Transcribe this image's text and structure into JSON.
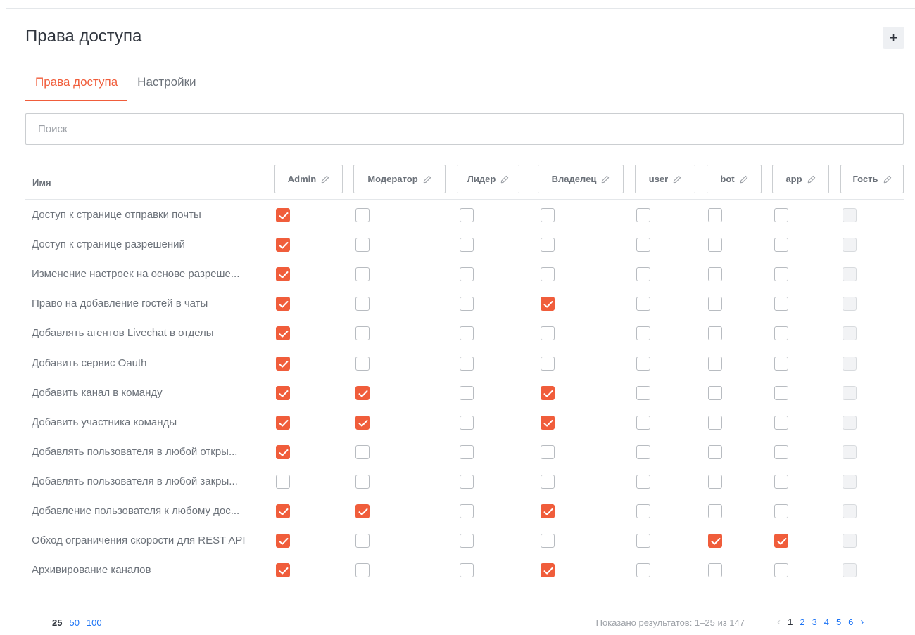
{
  "page": {
    "title": "Права доступа"
  },
  "tabs": [
    {
      "label": "Права доступа",
      "active": true
    },
    {
      "label": "Настройки",
      "active": false
    }
  ],
  "search": {
    "placeholder": "Поиск",
    "value": ""
  },
  "table": {
    "name_header": "Имя",
    "roles": [
      "Admin",
      "Модератор",
      "Лидер",
      "Владелец",
      "user",
      "bot",
      "app",
      "Гость"
    ],
    "rows": [
      {
        "name": "Доступ к странице отправки почты",
        "checks": [
          1,
          0,
          0,
          0,
          0,
          0,
          0,
          0
        ]
      },
      {
        "name": "Доступ к странице разрешений",
        "checks": [
          1,
          0,
          0,
          0,
          0,
          0,
          0,
          0
        ]
      },
      {
        "name": "Изменение настроек на основе разреше...",
        "checks": [
          1,
          0,
          0,
          0,
          0,
          0,
          0,
          0
        ]
      },
      {
        "name": "Право на добавление гостей в чаты",
        "checks": [
          1,
          0,
          0,
          1,
          0,
          0,
          0,
          0
        ]
      },
      {
        "name": "Добавлять агентов Livechat в отделы",
        "checks": [
          1,
          0,
          0,
          0,
          0,
          0,
          0,
          0
        ]
      },
      {
        "name": "Добавить сервис Oauth",
        "checks": [
          1,
          0,
          0,
          0,
          0,
          0,
          0,
          0
        ]
      },
      {
        "name": "Добавить канал в команду",
        "checks": [
          1,
          1,
          0,
          1,
          0,
          0,
          0,
          0
        ]
      },
      {
        "name": "Добавить участника команды",
        "checks": [
          1,
          1,
          0,
          1,
          0,
          0,
          0,
          0
        ]
      },
      {
        "name": "Добавлять пользователя в любой откры...",
        "checks": [
          1,
          0,
          0,
          0,
          0,
          0,
          0,
          0
        ]
      },
      {
        "name": "Добавлять пользователя в любой закры...",
        "checks": [
          0,
          0,
          0,
          0,
          0,
          0,
          0,
          0
        ]
      },
      {
        "name": "Добавление пользователя к любому дос...",
        "checks": [
          1,
          1,
          0,
          1,
          0,
          0,
          0,
          0
        ]
      },
      {
        "name": "Обход ограничения скорости для REST API",
        "checks": [
          1,
          0,
          0,
          0,
          0,
          1,
          1,
          0
        ]
      },
      {
        "name": "Архивирование каналов",
        "checks": [
          1,
          0,
          0,
          1,
          0,
          0,
          0,
          0
        ]
      }
    ],
    "disabled_role": "Гость"
  },
  "footer": {
    "per_page_options": [
      "25",
      "50",
      "100"
    ],
    "per_page_current": "25",
    "results_text": "Показано результатов: 1–25 из 147",
    "pages": [
      "1",
      "2",
      "3",
      "4",
      "5",
      "6"
    ],
    "current_page": "1"
  },
  "colors": {
    "accent": "#f05d3b",
    "link": "#1d74f5",
    "text": "#2f343d",
    "muted": "#6c727a"
  },
  "icons": {
    "add": "plus-icon",
    "edit": "pencil-icon",
    "check": "checkmark-icon",
    "prev": "chevron-left-icon",
    "next": "chevron-right-icon"
  }
}
